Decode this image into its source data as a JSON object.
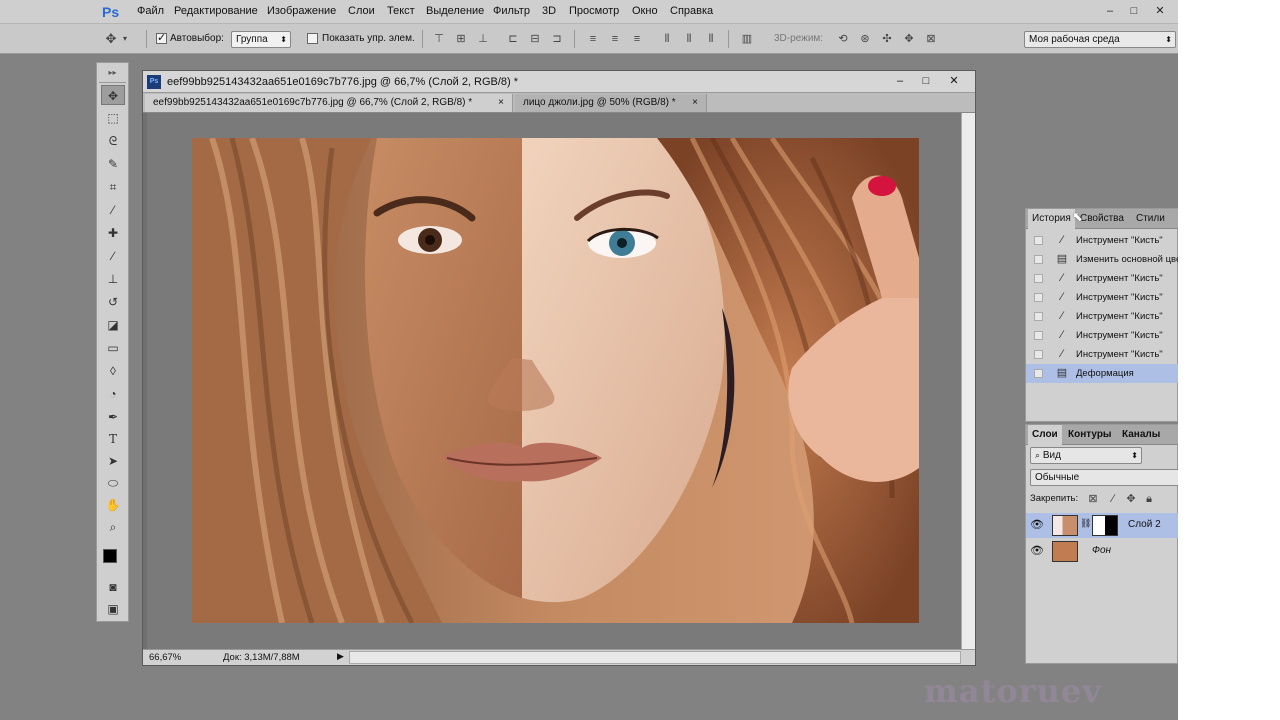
{
  "app": {
    "logo": "Ps",
    "menu": [
      "Файл",
      "Редактирование",
      "Изображение",
      "Слои",
      "Текст",
      "Выделение",
      "Фильтр",
      "3D",
      "Просмотр",
      "Окно",
      "Справка"
    ],
    "window_controls": [
      "–",
      "□",
      "✕"
    ]
  },
  "options": {
    "autoselect_label": "Автовыбор:",
    "autoselect_checked": true,
    "autoselect_value": "Группа",
    "show_controls_label": "Показать упр. элем.",
    "mode3d_label": "3D-режим:",
    "workspace": "Моя рабочая среда"
  },
  "document": {
    "title": "eef99bb925143432aa651e0169c7b776.jpg @ 66,7% (Слой 2, RGB/8) *",
    "tabs": [
      {
        "label": "eef99bb925143432aa651e0169c7b776.jpg @ 66,7% (Слой 2, RGB/8) *",
        "active": true
      },
      {
        "label": "лицо джоли.jpg @ 50% (RGB/8) *",
        "active": false
      }
    ],
    "window_controls": [
      "–",
      "□",
      "✕"
    ],
    "zoom": "66,67%",
    "doc_size": "Док: 3,13M/7,88M"
  },
  "tools": [
    "move",
    "marquee",
    "lasso",
    "quick-select",
    "crop",
    "eyedropper",
    "healing",
    "brush",
    "stamp",
    "history-brush",
    "eraser",
    "gradient",
    "blur",
    "dodge",
    "pen",
    "type",
    "path-select",
    "shape",
    "hand",
    "zoom"
  ],
  "history_panel": {
    "tabs": [
      "История",
      "Свойства",
      "Стили"
    ],
    "items": [
      {
        "label": "Инструмент \"Кисть\"",
        "icon": "brush-icon"
      },
      {
        "label": "Изменить основной цвет",
        "icon": "doc-icon"
      },
      {
        "label": "Инструмент \"Кисть\"",
        "icon": "brush-icon"
      },
      {
        "label": "Инструмент \"Кисть\"",
        "icon": "brush-icon"
      },
      {
        "label": "Инструмент \"Кисть\"",
        "icon": "brush-icon"
      },
      {
        "label": "Инструмент \"Кисть\"",
        "icon": "brush-icon"
      },
      {
        "label": "Инструмент \"Кисть\"",
        "icon": "brush-icon"
      },
      {
        "label": "Деформация",
        "icon": "doc-icon"
      }
    ],
    "selected_index": 7
  },
  "layers_panel": {
    "tabs": [
      "Слои",
      "Контуры",
      "Каналы"
    ],
    "filter": "Вид",
    "blend_mode": "Обычные",
    "lock_label": "Закрепить:",
    "layers": [
      {
        "name": "Слой 2",
        "visible": true,
        "has_mask": true
      },
      {
        "name": "Фон",
        "visible": true,
        "has_mask": false
      }
    ],
    "selected_index": 0
  },
  "watermark": "matoruev"
}
